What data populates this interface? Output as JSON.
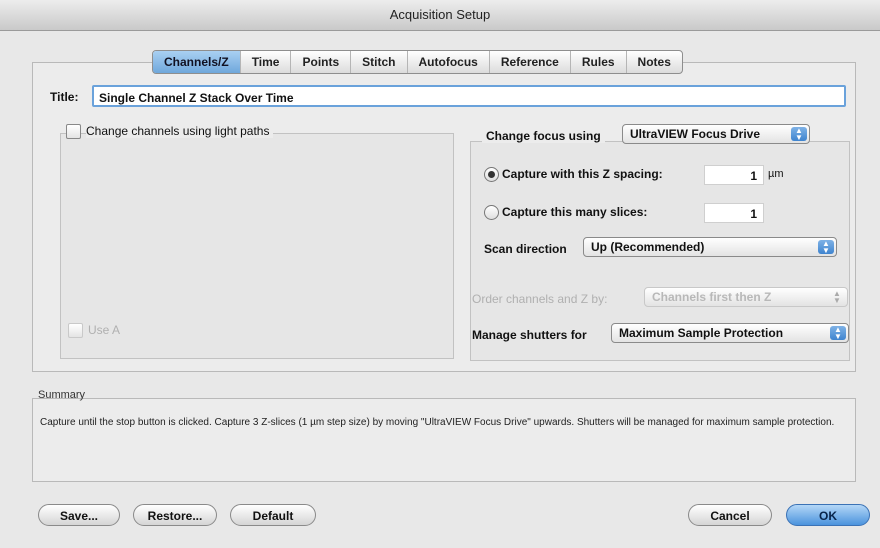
{
  "window": {
    "title": "Acquisition Setup"
  },
  "tabs": [
    "Channels/Z",
    "Time",
    "Points",
    "Stitch",
    "Autofocus",
    "Reference",
    "Rules",
    "Notes"
  ],
  "title_field": {
    "label": "Title:",
    "value": "Single Channel Z Stack Over Time"
  },
  "channels": {
    "light_paths_label": "Change channels using light paths",
    "light_paths_checked": false,
    "use_all_label": "Use A"
  },
  "focus": {
    "change_label": "Change focus using",
    "drive": "UltraVIEW Focus Drive",
    "capture_spacing_label": "Capture with this Z spacing:",
    "spacing_value": "1",
    "spacing_unit": "µm",
    "capture_slices_label": "Capture this many slices:",
    "slices_value": "1",
    "selected_mode": "spacing",
    "scan_label": "Scan direction",
    "scan_value": "Up (Recommended)",
    "order_label": "Order channels and Z by:",
    "order_value": "Channels first then Z",
    "shutters_label": "Manage shutters for",
    "shutters_value": "Maximum Sample Protection"
  },
  "summary": {
    "heading": "Summary",
    "text": "Capture until the stop button is clicked.  Capture 3 Z-slices (1 µm step size) by moving \"UltraVIEW Focus Drive\" upwards.  Shutters will be managed for maximum sample protection."
  },
  "buttons": {
    "save": "Save...",
    "restore": "Restore...",
    "default": "Default",
    "cancel": "Cancel",
    "ok": "OK"
  },
  "colors": {
    "accent": "#4b93dd",
    "tab_active": "#8cbde8"
  },
  "icons": {
    "popup_arrows": "up-down-arrows-icon",
    "check": "checkbox-icon",
    "radio": "radio-icon"
  }
}
